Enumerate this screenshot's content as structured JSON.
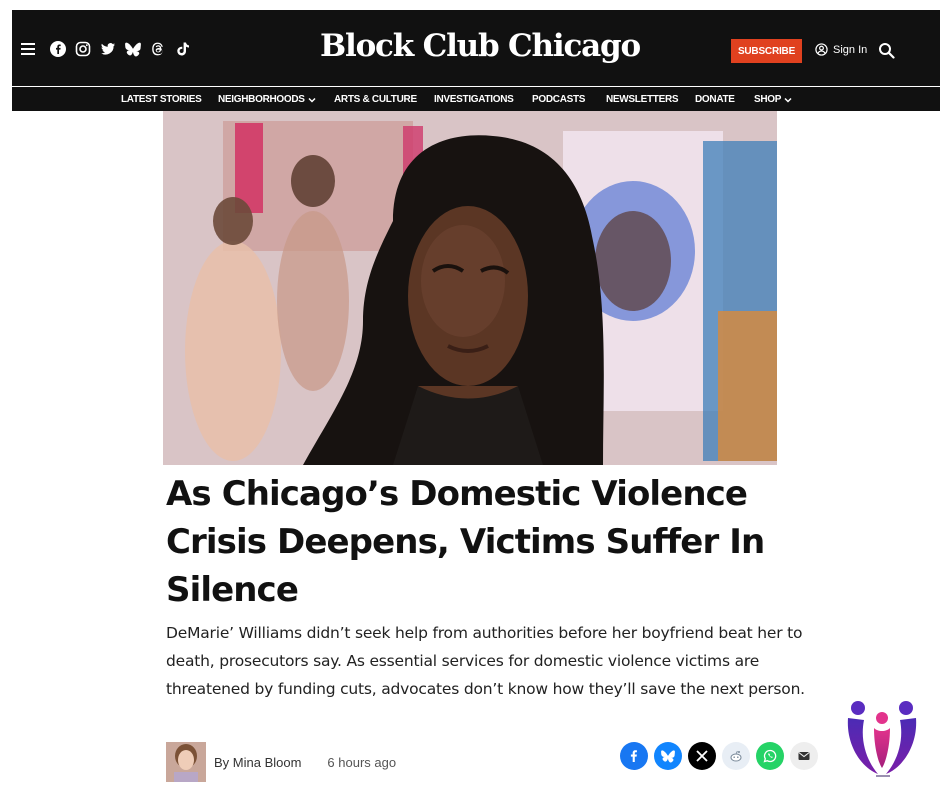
{
  "site": {
    "name": "Block Club Chicago",
    "subscribe_label": "SUBSCRIBE",
    "signin_label": "Sign In",
    "socials": [
      "facebook-icon",
      "instagram-icon",
      "twitter-icon",
      "bluesky-icon",
      "threads-icon",
      "tiktok-icon"
    ]
  },
  "nav": [
    {
      "label": "LATEST STORIES",
      "dropdown": false
    },
    {
      "label": "NEIGHBORHOODS",
      "dropdown": true
    },
    {
      "label": "ARTS & CULTURE",
      "dropdown": false
    },
    {
      "label": "INVESTIGATIONS",
      "dropdown": false
    },
    {
      "label": "PODCASTS",
      "dropdown": false
    },
    {
      "label": "NEWSLETTERS",
      "dropdown": false
    },
    {
      "label": "DONATE",
      "dropdown": false
    },
    {
      "label": "SHOP",
      "dropdown": true
    }
  ],
  "article": {
    "headline": "As Chicago’s Domestic Violence Crisis Deepens, Victims Suffer In Silence",
    "dek": "DeMarie’ Williams didn’t seek help from authorities before her boyfriend beat her to death, prosecutors say. As essential services for domestic violence victims are threatened by funding cuts, advocates don’t know how they’ll save the next person.",
    "byline": "By Mina Bloom",
    "timestamp": "6 hours ago"
  },
  "share_buttons": [
    {
      "name": "facebook-share",
      "color": "#1877f2"
    },
    {
      "name": "bluesky-share",
      "color": "#1185fe"
    },
    {
      "name": "x-share",
      "color": "#000000"
    },
    {
      "name": "reddit-share",
      "color": "#e8eef5"
    },
    {
      "name": "whatsapp-share",
      "color": "#25d366"
    },
    {
      "name": "email-share",
      "color": "#eeeeee"
    }
  ],
  "colors": {
    "header_bg": "#111111",
    "accent": "#e0411f"
  }
}
